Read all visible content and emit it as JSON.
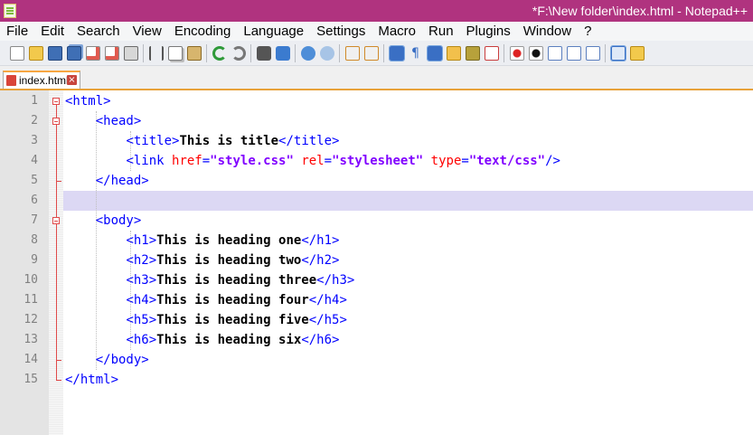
{
  "window": {
    "title": "*F:\\New folder\\index.html - Notepad++"
  },
  "menu": [
    "File",
    "Edit",
    "Search",
    "View",
    "Encoding",
    "Language",
    "Settings",
    "Macro",
    "Run",
    "Plugins",
    "Window",
    "?"
  ],
  "toolbar": {
    "icons": [
      "new-file-icon",
      "open-file-icon",
      "save-icon",
      "save-all-icon",
      "close-icon",
      "close-all-icon",
      "print-icon",
      "cut-icon",
      "copy-icon",
      "paste-icon",
      "undo-icon",
      "redo-icon",
      "find-icon",
      "replace-icon",
      "zoom-in-icon",
      "zoom-out-icon",
      "sync-vertical-icon",
      "sync-horizontal-icon",
      "word-wrap-icon",
      "show-all-characters-icon",
      "indent-guide-icon",
      "user-defined-language-icon",
      "document-map-icon",
      "function-list-icon",
      "record-macro-icon",
      "stop-recording-icon",
      "play-macro-icon",
      "run-macro-multiple-icon",
      "save-macro-icon",
      "spell-check-icon",
      "folder-as-workspace-icon"
    ]
  },
  "tabs": [
    {
      "label": "index.html",
      "modified": true
    }
  ],
  "editor": {
    "current_line": 6,
    "lines": [
      {
        "n": "1",
        "tokens": [
          {
            "t": "tag",
            "v": "<html>"
          }
        ]
      },
      {
        "n": "2",
        "tokens": [
          {
            "t": "ws",
            "v": "    "
          },
          {
            "t": "tag",
            "v": "<head>"
          }
        ]
      },
      {
        "n": "3",
        "tokens": [
          {
            "t": "ws",
            "v": "        "
          },
          {
            "t": "tag",
            "v": "<title>"
          },
          {
            "t": "txt",
            "v": "This is title"
          },
          {
            "t": "tag",
            "v": "</title>"
          }
        ]
      },
      {
        "n": "4",
        "tokens": [
          {
            "t": "ws",
            "v": "        "
          },
          {
            "t": "tag",
            "v": "<link "
          },
          {
            "t": "attr",
            "v": "href"
          },
          {
            "t": "tag",
            "v": "="
          },
          {
            "t": "val",
            "v": "\"style.css\""
          },
          {
            "t": "tag",
            "v": " "
          },
          {
            "t": "attr",
            "v": "rel"
          },
          {
            "t": "tag",
            "v": "="
          },
          {
            "t": "val",
            "v": "\"stylesheet\""
          },
          {
            "t": "tag",
            "v": " "
          },
          {
            "t": "attr",
            "v": "type"
          },
          {
            "t": "tag",
            "v": "="
          },
          {
            "t": "val",
            "v": "\"text/css\""
          },
          {
            "t": "tag",
            "v": "/>"
          }
        ]
      },
      {
        "n": "5",
        "tokens": [
          {
            "t": "ws",
            "v": "    "
          },
          {
            "t": "tag",
            "v": "</head>"
          }
        ]
      },
      {
        "n": "6",
        "tokens": []
      },
      {
        "n": "7",
        "tokens": [
          {
            "t": "ws",
            "v": "    "
          },
          {
            "t": "tag",
            "v": "<body>"
          }
        ]
      },
      {
        "n": "8",
        "tokens": [
          {
            "t": "ws",
            "v": "        "
          },
          {
            "t": "tag",
            "v": "<h1>"
          },
          {
            "t": "txt",
            "v": "This is heading one"
          },
          {
            "t": "tag",
            "v": "</h1>"
          }
        ]
      },
      {
        "n": "9",
        "tokens": [
          {
            "t": "ws",
            "v": "        "
          },
          {
            "t": "tag",
            "v": "<h2>"
          },
          {
            "t": "txt",
            "v": "This is heading two"
          },
          {
            "t": "tag",
            "v": "</h2>"
          }
        ]
      },
      {
        "n": "10",
        "tokens": [
          {
            "t": "ws",
            "v": "        "
          },
          {
            "t": "tag",
            "v": "<h3>"
          },
          {
            "t": "txt",
            "v": "This is heading three"
          },
          {
            "t": "tag",
            "v": "</h3>"
          }
        ]
      },
      {
        "n": "11",
        "tokens": [
          {
            "t": "ws",
            "v": "        "
          },
          {
            "t": "tag",
            "v": "<h4>"
          },
          {
            "t": "txt",
            "v": "This is heading four"
          },
          {
            "t": "tag",
            "v": "</h4>"
          }
        ]
      },
      {
        "n": "12",
        "tokens": [
          {
            "t": "ws",
            "v": "        "
          },
          {
            "t": "tag",
            "v": "<h5>"
          },
          {
            "t": "txt",
            "v": "This is heading five"
          },
          {
            "t": "tag",
            "v": "</h5>"
          }
        ]
      },
      {
        "n": "13",
        "tokens": [
          {
            "t": "ws",
            "v": "        "
          },
          {
            "t": "tag",
            "v": "<h6>"
          },
          {
            "t": "txt",
            "v": "This is heading six"
          },
          {
            "t": "tag",
            "v": "</h6>"
          }
        ]
      },
      {
        "n": "14",
        "tokens": [
          {
            "t": "ws",
            "v": "    "
          },
          {
            "t": "tag",
            "v": "</body>"
          }
        ]
      },
      {
        "n": "15",
        "tokens": [
          {
            "t": "tag",
            "v": "</html>"
          }
        ]
      }
    ]
  },
  "colors": {
    "titlebar": "#b0337f",
    "tag": "#0000ff",
    "attribute": "#ff0000",
    "value": "#8000ff",
    "current_line": "#dcd8f4",
    "fold_marker": "#e04a4a"
  }
}
